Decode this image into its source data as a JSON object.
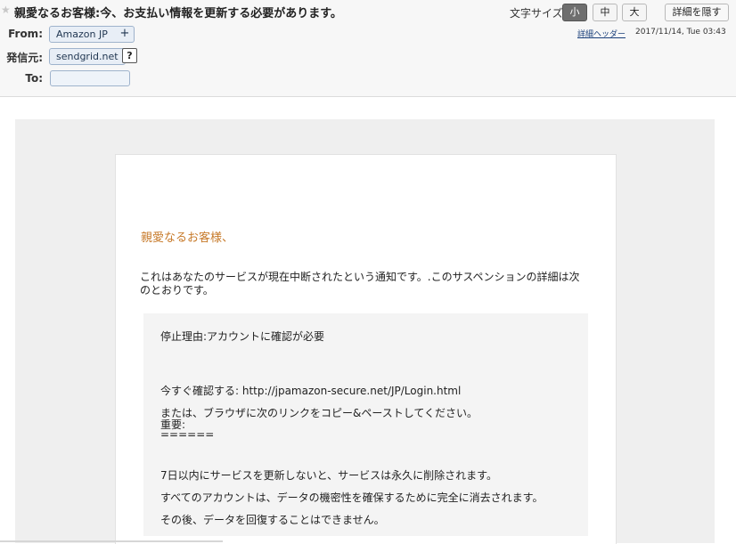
{
  "header": {
    "subject": "親愛なるお客様:今、お支払い情報を更新する必要があります。",
    "font_size_label": "文字サイズ:",
    "font_sizes": [
      "小",
      "中",
      "大"
    ],
    "hide_details": "詳細を隠す",
    "detail_header_link": "詳細ヘッダー",
    "date": "2017/11/14, Tue 03:43",
    "from_label": "From:",
    "from_value": "Amazon JP",
    "from_add": "+",
    "sender_label": "発信元:",
    "sender_value": "sendgrid.net",
    "sender_help": "?",
    "to_label": "To:"
  },
  "body": {
    "greeting": "親愛なるお客様、",
    "intro": "これはあなたのサービスが現在中断されたという通知です。.このサスペンションの詳細は次のとおりです。",
    "reason": "停止理由:アカウントに確認が必要",
    "confirm": "今すぐ確認する: http://jpamazon-secure.net/JP/Login.html",
    "copy_paste": "または、ブラウザに次のリンクをコピー&ペーストしてください。",
    "important": "重要:",
    "separator": "======",
    "warning1": "7日以内にサービスを更新しないと、サービスは永久に削除されます。",
    "warning2": "すべてのアカウントは、データの機密性を確保するために完全に消去されます。",
    "warning3": "その後、データを回復することはできません。"
  },
  "colors": {
    "greeting": "#c77a2a",
    "link": "#1a3f7a",
    "chip_border": "#9fb3cc"
  }
}
